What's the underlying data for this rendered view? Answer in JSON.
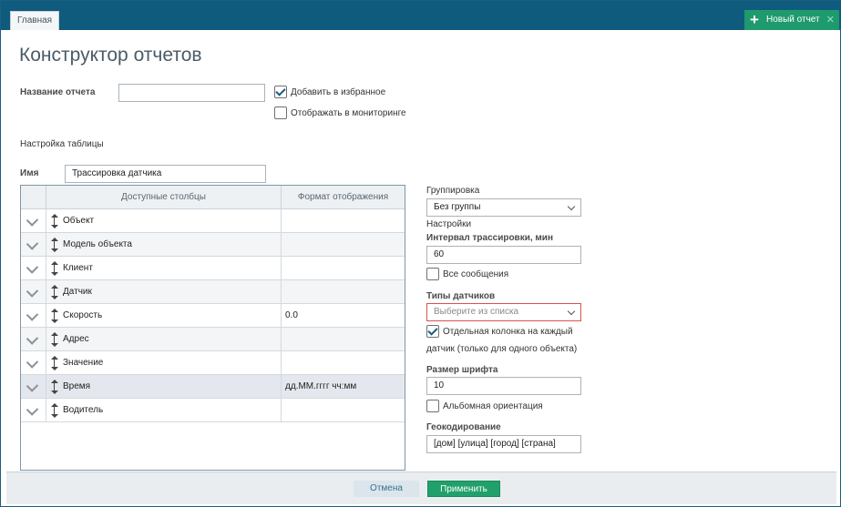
{
  "window": {
    "home_tab": "Главная",
    "new_report_label": "Новый отчет"
  },
  "page": {
    "title": "Конструктор отчетов"
  },
  "report": {
    "name_label": "Название отчета",
    "name_value": "",
    "favorite_label": "Добавить в избранное",
    "favorite_checked": true,
    "monitoring_label": "Отображать в мониторинге",
    "monitoring_checked": false
  },
  "table_settings": {
    "section_label": "Настройка таблицы",
    "name_label": "Имя",
    "name_value": "Трассировка датчика"
  },
  "columns_grid": {
    "headers": [
      "Доступные столбцы",
      "Формат отображения"
    ],
    "rows": [
      {
        "name": "Объект",
        "format": "",
        "checked": true
      },
      {
        "name": "Модель объекта",
        "format": "",
        "checked": true
      },
      {
        "name": "Клиент",
        "format": "",
        "checked": true
      },
      {
        "name": "Датчик",
        "format": "",
        "checked": true
      },
      {
        "name": "Скорость",
        "format": "0.0",
        "checked": true
      },
      {
        "name": "Адрес",
        "format": "",
        "checked": true
      },
      {
        "name": "Значение",
        "format": "",
        "checked": true
      },
      {
        "name": "Время",
        "format": "дд.ММ.гггг чч:мм",
        "checked": true,
        "selected": true
      },
      {
        "name": "Водитель",
        "format": "",
        "checked": true
      }
    ]
  },
  "options": {
    "grouping_label": "Группировка",
    "grouping_value": "Без группы",
    "settings_label": "Настройки",
    "interval_label": "Интервал трассировки, мин",
    "interval_value": "60",
    "all_messages_label": "Все сообщения",
    "sensor_types_label": "Типы датчиков",
    "sensor_types_placeholder": "Выберите из списка",
    "separate_column_label_1": "Отдельная колонка на каждый",
    "separate_column_label_2": "датчик (только для одного объекта)",
    "separate_column_checked": true,
    "font_size_label": "Размер шрифта",
    "font_size_value": "10",
    "landscape_label": "Альбомная ориентация",
    "geocoding_label": "Геокодирование",
    "geocoding_value": "[дом] [улица] [город] [страна]"
  },
  "footer": {
    "cancel_label": "Отмена",
    "apply_label": "Применить"
  },
  "colors": {
    "topbar": "#0f5b7e",
    "accent_green": "#22a06b",
    "error_border": "#d9534f"
  }
}
